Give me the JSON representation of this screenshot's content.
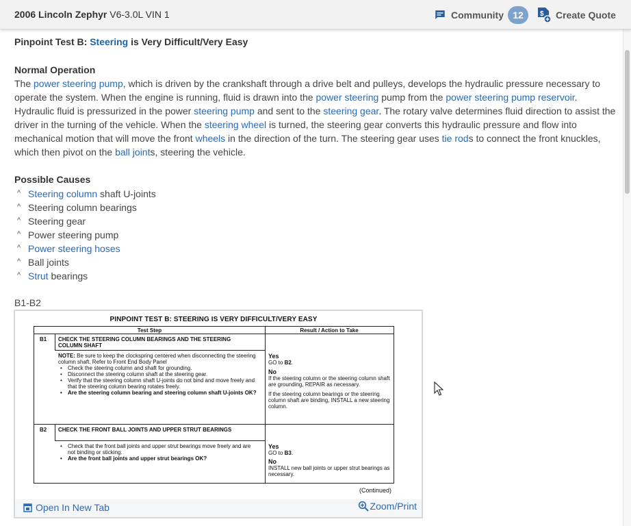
{
  "header": {
    "vehicle_bold": "2006 Lincoln Zephyr",
    "vehicle_rest": " V6-3.0L VIN 1",
    "community_label": "Community",
    "community_count": "12",
    "create_quote_label": "Create Quote"
  },
  "page": {
    "title_prefix": "Pinpoint Test B: ",
    "title_link": "Steering",
    "title_suffix": " is Very Difficult/Very Easy"
  },
  "normal_operation": {
    "heading": "Normal Operation",
    "p": [
      " The ",
      "power steering pump",
      ", which is driven by the crankshaft through a drive belt and pulleys, develops the hydraulic pressure necessary to operate the system. When the engine is running, fluid is drawn into the ",
      "power steering",
      " pump from the ",
      "power steering pump reservoir",
      ". Hydraulic fluid is pressurized in the power ",
      "steering pump",
      " and sent to the ",
      "steering gear",
      ". The rotary valve determines fluid direction to assist the driver in the turning of the vehicle. When the ",
      "steering wheel",
      " is turned, the steering gear converts this hydraulic pressure and flow into mechanical motion that will move the front ",
      "wheels",
      " in the direction of the turn. The steering gear uses ",
      "tie rod",
      "s to connect the front knuckles, which then pivot on the ",
      "ball joint",
      "s, steering the vehicle."
    ]
  },
  "possible_causes": {
    "heading": "Possible Causes",
    "items": [
      {
        "link": "Steering column",
        "text": " shaft U-joints"
      },
      {
        "link": "",
        "text": "Steering column bearings"
      },
      {
        "link": "",
        "text": "Steering gear"
      },
      {
        "link": "",
        "text": "Power steering pump"
      },
      {
        "link": "Power steering hoses",
        "text": ""
      },
      {
        "link": "",
        "text": "Ball joints"
      },
      {
        "link": "Strut",
        "text": " bearings"
      }
    ]
  },
  "figure": {
    "label": "B1-B2",
    "open_tab": "Open In New Tab",
    "zoom": "Zoom/Print",
    "scan": {
      "title": "PINPOINT TEST B: STEERING IS VERY DIFFICULT/VERY EASY",
      "col_step": "Test Step",
      "col_result": "Result / Action to Take",
      "b1_id": "B1",
      "b1_head": "CHECK THE STEERING COLUMN BEARINGS AND THE STEERING COLUMN SHAFT",
      "b1_note_bold": "NOTE:",
      "b1_note": " Be sure to keep the clockspring centered when disconnecting the steering column shaft. Refer to Front End Body Panel",
      "b1_items": [
        "Check the steering column and shaft for grounding.",
        "Disconnect the steering column shaft at the steering gear.",
        "Verify that the steering column shaft U-joints do not bind and move freely and that the steering column bearing rotates freely."
      ],
      "b1_question": "Are the steering column bearing and steering column shaft U-joints OK?",
      "b1_yes": "Yes",
      "b1_yes_prefix": "GO to ",
      "b1_yes_target": "B2",
      "b1_yes_suffix": ".",
      "b1_no": "No",
      "b1_no_1": "If the steering column or the steering column shaft are grounding, REPAIR as necessary.",
      "b1_no_2": "If the steering column bearings or the steering column shaft are binding, INSTALL a new steering column.",
      "b2_id": "B2",
      "b2_head": "CHECK THE FRONT BALL JOINTS AND UPPER STRUT BEARINGS",
      "b2_item": "Check that the front ball joints and upper strut bearings move freely and are not binding or sticking.",
      "b2_question": "Are the front ball joints and upper strut bearings OK?",
      "b2_yes": "Yes",
      "b2_yes_prefix": "GO to ",
      "b2_yes_target": "B3",
      "b2_yes_suffix": ".",
      "b2_no": "No",
      "b2_no_1": "INSTALL new ball joints or upper strut bearings as necessary.",
      "continued": "(Continued)"
    }
  },
  "colors": {
    "link": "#2a6ab5",
    "badge": "#7da3cd",
    "topbar": "#f2f2f2"
  }
}
